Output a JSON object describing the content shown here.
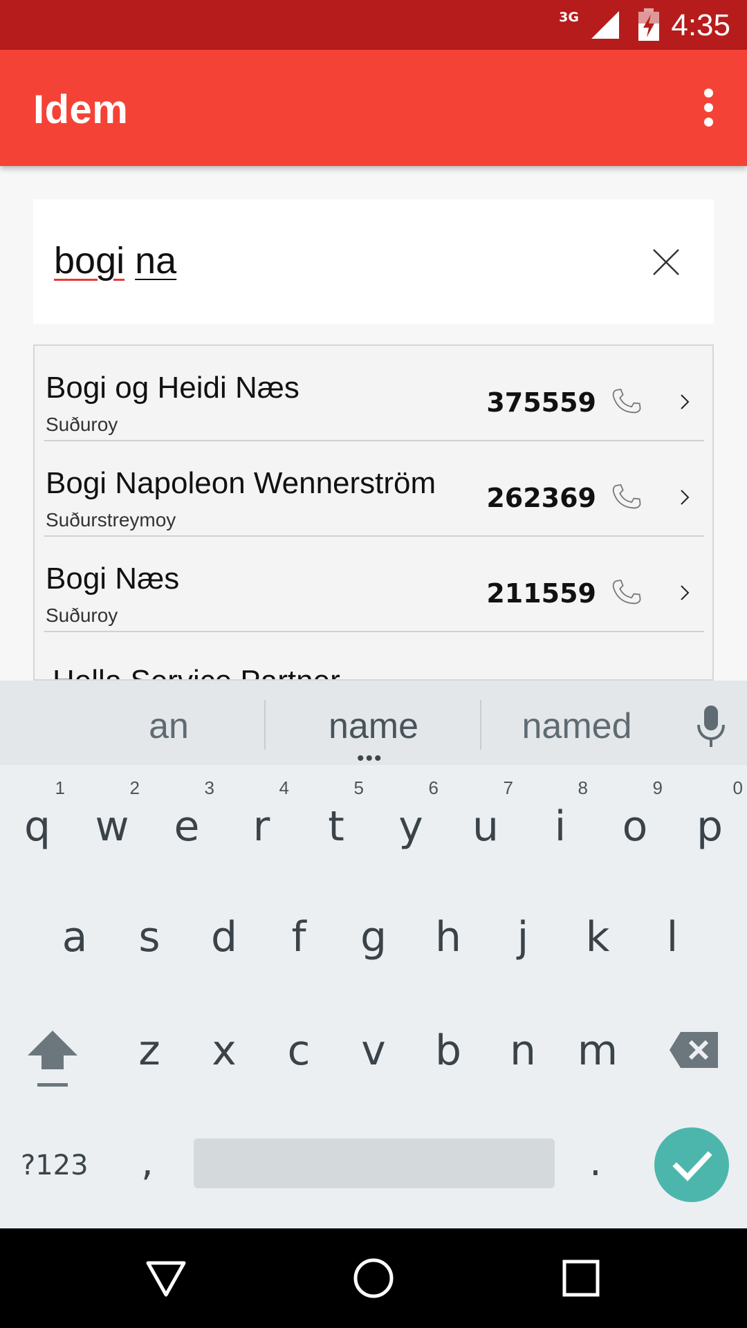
{
  "status_bar": {
    "network": "3G",
    "time": "4:35",
    "signal_icon": "cell-signal-icon",
    "battery_icon": "battery-charging-icon"
  },
  "app_bar": {
    "title": "Idem",
    "menu_icon": "overflow-menu-icon"
  },
  "search": {
    "word1": "bogi",
    "word2": "na",
    "clear_icon": "close-icon"
  },
  "results": [
    {
      "name": "Bogi og Heidi Næs",
      "area": "Suðuroy",
      "phone": "375559"
    },
    {
      "name": "Bogi Napoleon Wennerström",
      "area": "Suðurstreymoy",
      "phone": "262369"
    },
    {
      "name": "Bogi Næs",
      "area": "Suðuroy",
      "phone": "211559"
    },
    {
      "name": "Hella Service Partner",
      "area": "",
      "phone": ""
    }
  ],
  "keyboard": {
    "suggestions": [
      "an",
      "name",
      "named"
    ],
    "row1": [
      {
        "ch": "q",
        "num": "1"
      },
      {
        "ch": "w",
        "num": "2"
      },
      {
        "ch": "e",
        "num": "3"
      },
      {
        "ch": "r",
        "num": "4"
      },
      {
        "ch": "t",
        "num": "5"
      },
      {
        "ch": "y",
        "num": "6"
      },
      {
        "ch": "u",
        "num": "7"
      },
      {
        "ch": "i",
        "num": "8"
      },
      {
        "ch": "o",
        "num": "9"
      },
      {
        "ch": "p",
        "num": "0"
      }
    ],
    "row2": [
      "a",
      "s",
      "d",
      "f",
      "g",
      "h",
      "j",
      "k",
      "l"
    ],
    "row3": [
      "z",
      "x",
      "c",
      "v",
      "b",
      "n",
      "m"
    ],
    "symbols_label": "?123",
    "comma": ",",
    "period": "."
  },
  "colors": {
    "status_bar": "#b71c1c",
    "app_bar": "#f44336",
    "done_button": "#4db6ac"
  }
}
